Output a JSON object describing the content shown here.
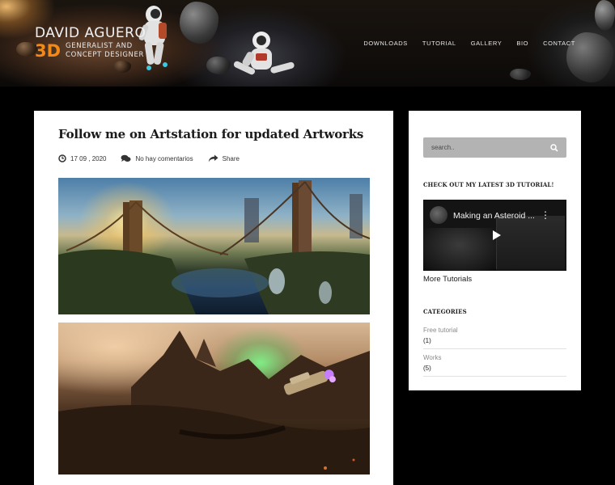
{
  "header": {
    "logo_name": "DAVID AGUERO",
    "logo_3d": "3D",
    "logo_sub_1": "GENERALIST AND",
    "logo_sub_2": "CONCEPT DESIGNER",
    "nav": [
      "DOWNLOADS",
      "TUTORIAL",
      "GALLERY",
      "BIO",
      "CONTACT"
    ]
  },
  "post": {
    "title": "Follow me on Artstation for updated Artworks",
    "date": "17 09 , 2020",
    "comments": "No hay comentarios",
    "share": "Share",
    "icons": [
      "clock-icon",
      "comments-icon",
      "share-icon"
    ]
  },
  "sidebar": {
    "search_placeholder": "search..",
    "tutorial_heading": "CHECK OUT MY LATEST 3D TUTORIAL!",
    "video_title": "Making an Asteroid ...",
    "more_tutorials": "More Tutorials",
    "categories_heading": "CATEGORIES",
    "categories": [
      {
        "name": "Free tutorial",
        "count": "(1)"
      },
      {
        "name": "Works",
        "count": "(5)"
      }
    ]
  },
  "colors": {
    "accent": "#f28a17",
    "page_bg": "#000000",
    "card_bg": "#ffffff",
    "search_bg": "#b3b3b3"
  }
}
